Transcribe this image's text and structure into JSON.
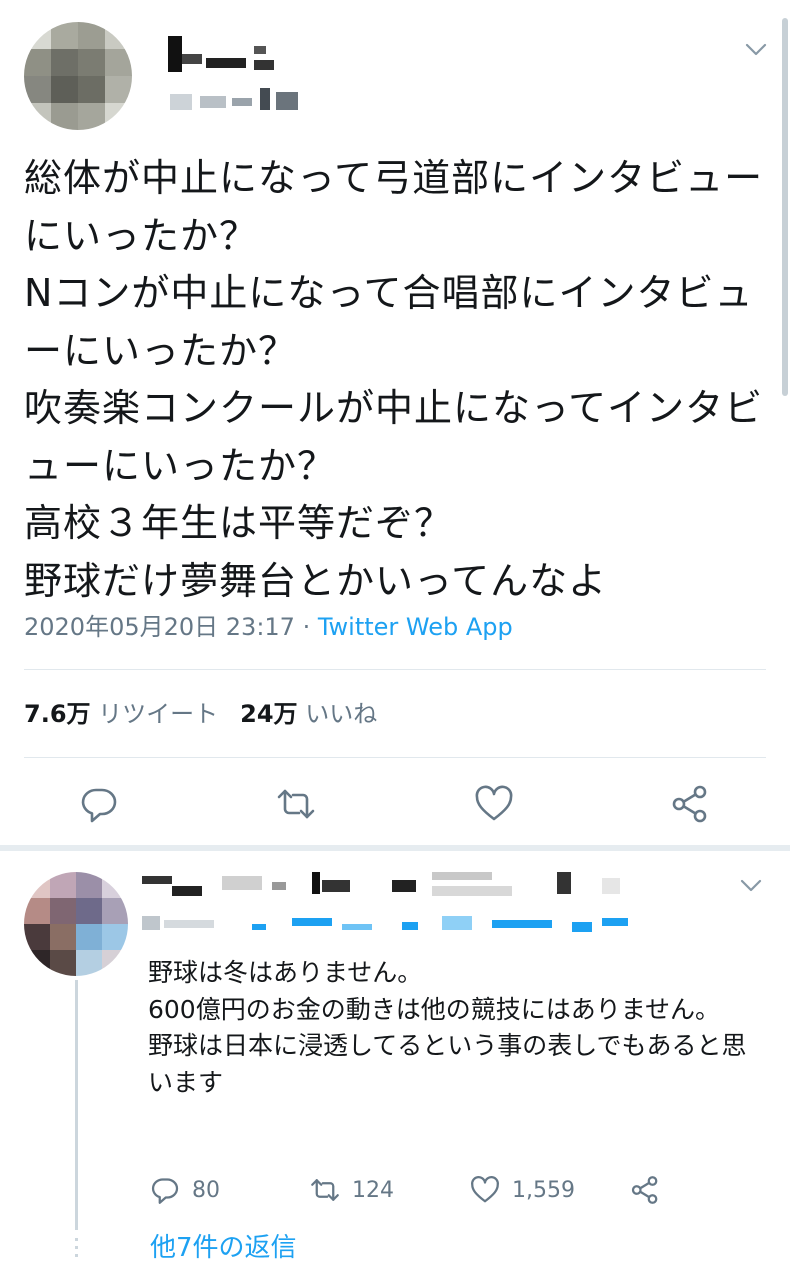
{
  "tweet": {
    "text": "総体が中止になって弓道部にインタビューにいったか？\nNコンが中止になって合唱部にインタビューにいったか？\n吹奏楽コンクールが中止になってインタビューにいったか？\n高校３年生は平等だぞ？\n野球だけ夢舞台とかいってんなよ",
    "timestamp": "2020年05月20日 23:17",
    "separator": " · ",
    "source": "Twitter Web App",
    "retweet_count": "7.6万",
    "retweet_label": "リツイート",
    "like_count": "24万",
    "like_label": "いいね"
  },
  "reply": {
    "text": "野球は冬はありません。\n600億円のお金の動きは他の競技にはありません。\n野球は日本に浸透してるという事の表しでもあると思います",
    "reply_count": "80",
    "retweet_count": "124",
    "like_count": "1,559"
  },
  "more_replies_label": "他7件の返信",
  "icons": [
    "chevron-down-icon",
    "reply-icon",
    "retweet-icon",
    "like-icon",
    "share-icon"
  ],
  "colors": {
    "accent": "#1da1f2",
    "secondary_text": "#657786",
    "divider": "#e1e8ed"
  }
}
